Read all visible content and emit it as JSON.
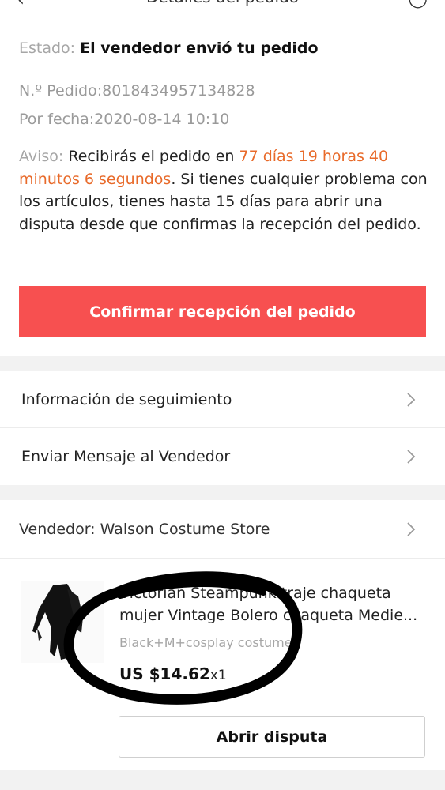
{
  "header": {
    "back_icon": "arrow-left-icon",
    "title": "Detalles del pedido",
    "help_icon": "chat-icon"
  },
  "order": {
    "status_label": "Estado:",
    "status_value": "El vendedor envió tu pedido",
    "order_number": "N.º Pedido:8018434957134828",
    "order_date": "Por fecha:2020-08-14 10:10"
  },
  "notice": {
    "label": "Aviso:",
    "prefix": " Recibirás el pedido en ",
    "countdown": "77 días 19 horas 40 minutos 6 segundos",
    "suffix": ". Si tienes cualquier problema con los artículos, tienes hasta 15 días para abrir una disputa desde que confirmas la recepción del pedido."
  },
  "actions": {
    "confirm_label": "Confirmar recepción del pedido",
    "tracking_label": "Información de seguimiento",
    "message_label": "Enviar Mensaje al Vendedor",
    "dispute_label": "Abrir disputa"
  },
  "seller": {
    "label": "Vendedor: Walson Costume Store"
  },
  "product": {
    "title": "Victorian Steampunk traje chaqueta mujer Vintage Bolero chaqueta Medie...",
    "variant": "Black+M+cosplay costume",
    "price": "US $14.62",
    "quantity": "x1"
  },
  "colors": {
    "confirm_button": "#f75050",
    "countdown": "#e86a2a",
    "section_gap": "#f2f2f2"
  }
}
